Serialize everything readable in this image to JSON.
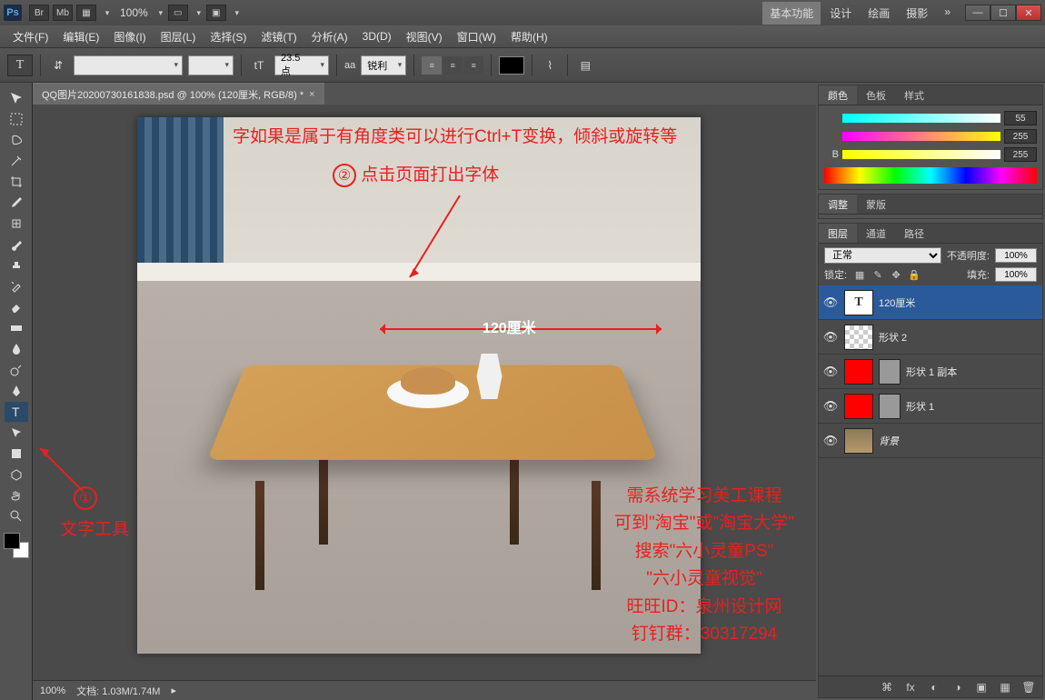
{
  "titlebar": {
    "app_icon": "Ps",
    "btn_br": "Br",
    "btn_mb": "Mb",
    "zoom": "100%",
    "workspace": {
      "active": "基本功能",
      "items": [
        "基本功能",
        "设计",
        "绘画",
        "摄影"
      ]
    },
    "more": "»"
  },
  "menu": {
    "file": "文件(F)",
    "edit": "编辑(E)",
    "image": "图像(I)",
    "layer": "图层(L)",
    "select": "选择(S)",
    "filter": "滤镜(T)",
    "analysis": "分析(A)",
    "3d": "3D(D)",
    "view": "视图(V)",
    "window": "窗口(W)",
    "help": "帮助(H)"
  },
  "options": {
    "tool_glyph": "T",
    "font_size": "23.5 点",
    "aa_label": "aa",
    "aa_value": "锐利"
  },
  "document": {
    "tab": "QQ图片20200730161838.psd @ 100% (120厘米, RGB/8) *"
  },
  "canvas": {
    "dim_label": "120厘米"
  },
  "annotations": {
    "note1_num": "①",
    "note1_text": "文字工具",
    "note2_num": "②",
    "note2_text": "点击页面打出字体",
    "note_top": "字如果是属于有角度类可以进行Ctrl+T变换，倾斜或旋转等",
    "promo1": "需系统学习美工课程",
    "promo2": "可到\"淘宝\"或\"淘宝大学\"",
    "promo3": "搜索\"六小灵童PS\"",
    "promo4": "\"六小灵童视觉\"",
    "promo5": "旺旺ID：泉州设计网",
    "promo6": "钉钉群：30317294"
  },
  "status": {
    "zoom": "100%",
    "doc_info": "文档: 1.03M/1.74M"
  },
  "panels": {
    "color": {
      "tab_color": "颜色",
      "tab_swatches": "色板",
      "tab_styles": "样式",
      "r": "55",
      "g": "255",
      "b_label": "B",
      "b": "255"
    },
    "adjustments": {
      "tab_adj": "调整",
      "tab_mask": "蒙版"
    },
    "layers": {
      "tab_layers": "图层",
      "tab_channels": "通道",
      "tab_paths": "路径",
      "blend_mode": "正常",
      "opacity_label": "不透明度:",
      "opacity_val": "100%",
      "lock_label": "锁定:",
      "fill_label": "填充:",
      "fill_val": "100%",
      "items": [
        {
          "name": "120厘米",
          "type": "text",
          "selected": true
        },
        {
          "name": "形状 2",
          "type": "checker"
        },
        {
          "name": "形状 1 副本",
          "type": "shape-red"
        },
        {
          "name": "形状 1",
          "type": "shape-red"
        },
        {
          "name": "背景",
          "type": "bg-img"
        }
      ]
    }
  }
}
